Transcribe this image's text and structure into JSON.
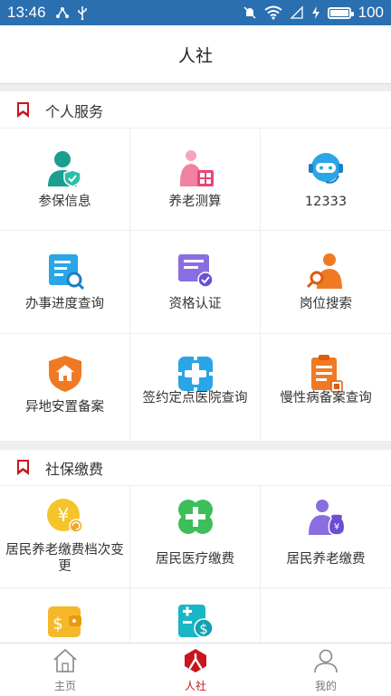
{
  "status_bar": {
    "time": "13:46",
    "battery_level": "100",
    "battery_fraction": 1.0
  },
  "title": "人社",
  "sections": [
    {
      "title": "个人服务",
      "items": [
        {
          "label": "参保信息",
          "icon": "user-shield-icon"
        },
        {
          "label": "养老测算",
          "icon": "elder-calculator-icon"
        },
        {
          "label": "12333",
          "icon": "customer-service-robot-icon"
        },
        {
          "label": "办事进度查询",
          "icon": "document-search-icon"
        },
        {
          "label": "资格认证",
          "icon": "certificate-check-icon"
        },
        {
          "label": "岗位搜索",
          "icon": "job-search-icon"
        },
        {
          "label": "异地安置备案",
          "icon": "house-shield-icon"
        },
        {
          "label": "签约定点医院查询",
          "icon": "hospital-cross-icon"
        },
        {
          "label": "慢性病备案查询",
          "icon": "clipboard-list-icon"
        }
      ]
    },
    {
      "title": "社保缴费",
      "items": [
        {
          "label": "居民养老缴费档次变更",
          "icon": "yuan-coin-icon"
        },
        {
          "label": "居民医疗缴费",
          "icon": "medical-clover-icon"
        },
        {
          "label": "居民养老缴费",
          "icon": "elder-payment-icon"
        },
        {
          "label": "",
          "icon": "wallet-dollar-icon"
        },
        {
          "label": "",
          "icon": "payment-calc-icon"
        },
        {
          "label": "",
          "icon": ""
        }
      ]
    }
  ],
  "bottom_nav": [
    {
      "label": "主页",
      "icon": "home-icon",
      "active": false
    },
    {
      "label": "人社",
      "icon": "renshe-logo-icon",
      "active": true
    },
    {
      "label": "我的",
      "icon": "profile-icon",
      "active": false
    }
  ],
  "colors": {
    "status_bar": "#2a6fb0",
    "accent_red": "#c8161d"
  }
}
